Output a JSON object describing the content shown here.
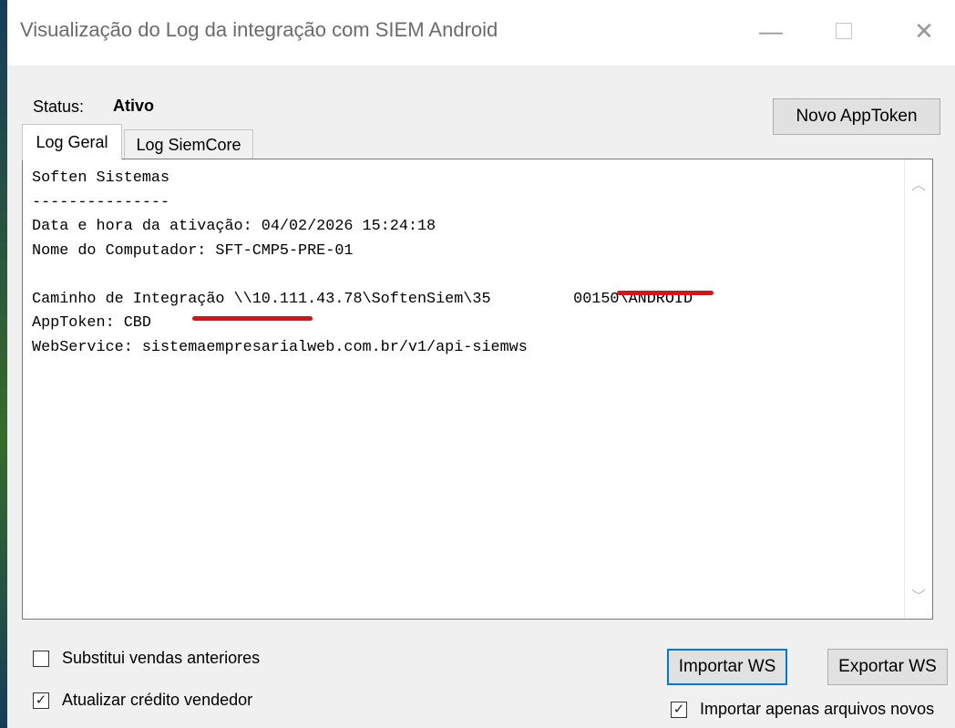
{
  "window": {
    "title": "Visualização do Log da integração com SIEM Android",
    "minimize_glyph": "—",
    "close_glyph": "✕"
  },
  "status": {
    "label": "Status:",
    "value": "Ativo"
  },
  "buttons": {
    "novo_apptoken": "Novo AppToken",
    "importar_ws": "Importar WS",
    "exportar_ws": "Exportar WS"
  },
  "tabs": [
    {
      "label": "Log Geral",
      "active": true
    },
    {
      "label": "Log SiemCore",
      "active": false
    }
  ],
  "log": {
    "text": "Soften Sistemas\n---------------\nData e hora da ativação: 04/02/2026 15:24:18\nNome do Computador: SFT-CMP5-PRE-01\n\nCaminho de Integração \\\\10.111.43.78\\SoftenSiem\\35         00150\\ANDROID\nAppToken: CBD\nWebService: sistemaempresarialweb.com.br/v1/api-siemws"
  },
  "icons": {
    "scroll_up": "chevron-up-icon",
    "scroll_down": "chevron-down-icon",
    "check": "checkmark-icon"
  },
  "options": {
    "substitui_vendas": {
      "label": "Substitui vendas anteriores",
      "checked": false
    },
    "atualizar_credito": {
      "label": "Atualizar crédito vendedor",
      "checked": true
    },
    "importar_apenas": {
      "label": "Importar apenas arquivos novos",
      "checked": true
    }
  },
  "colors": {
    "redaction": "#e01010",
    "focus_border": "#0078d7"
  }
}
